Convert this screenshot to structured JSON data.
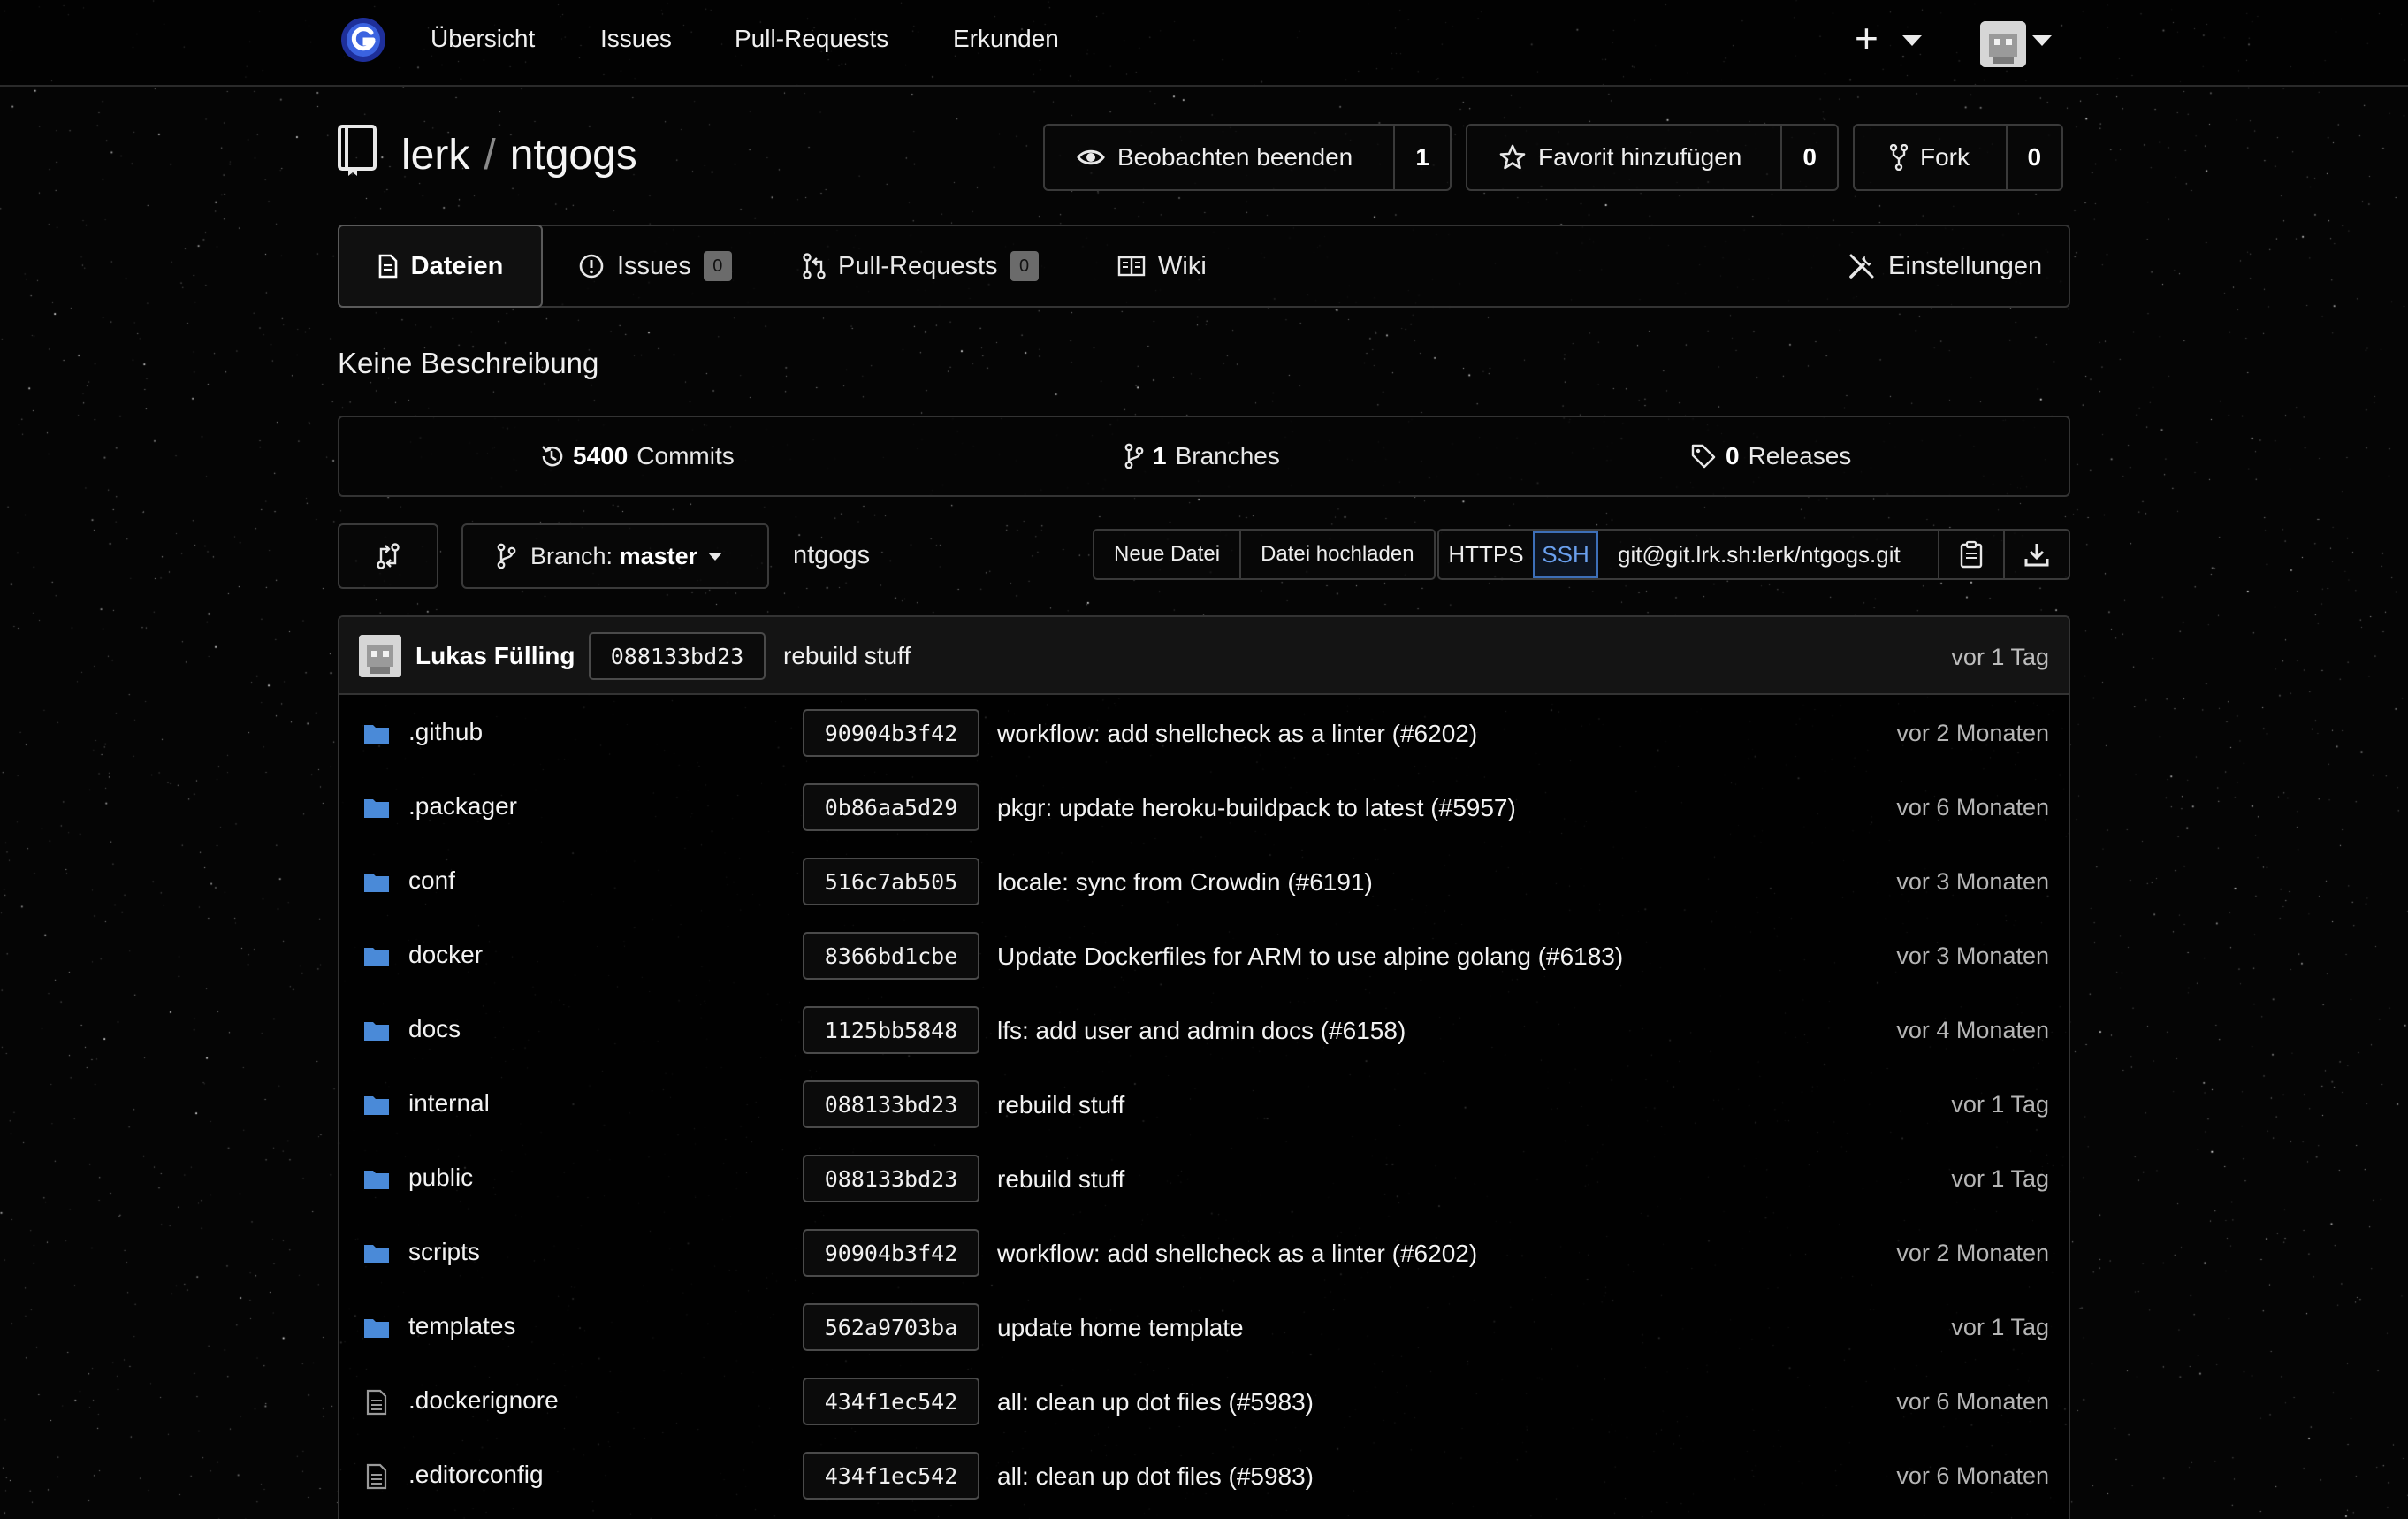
{
  "nav": {
    "links": [
      "Übersicht",
      "Issues",
      "Pull-Requests",
      "Erkunden"
    ]
  },
  "repo": {
    "owner": "lerk",
    "separator": "/",
    "name": "ntgogs",
    "watch": {
      "label": "Beobachten beenden",
      "count": "1"
    },
    "star": {
      "label": "Favorit hinzufügen",
      "count": "0"
    },
    "fork": {
      "label": "Fork",
      "count": "0"
    }
  },
  "tabs": {
    "files": "Dateien",
    "issues": "Issues",
    "issues_count": "0",
    "pulls": "Pull-Requests",
    "pulls_count": "0",
    "wiki": "Wiki",
    "settings": "Einstellungen"
  },
  "description": "Keine Beschreibung",
  "stats": {
    "commits_num": "5400",
    "commits_label": "Commits",
    "branches_num": "1",
    "branches_label": "Branches",
    "releases_num": "0",
    "releases_label": "Releases"
  },
  "toolbar": {
    "branch_prefix": "Branch:",
    "branch_name": "master",
    "path": "ntgogs",
    "new_file": "Neue Datei",
    "upload_file": "Datei hochladen",
    "https": "HTTPS",
    "ssh": "SSH",
    "clone_url": "git@git.lrk.sh:lerk/ntgogs.git"
  },
  "latest_commit": {
    "author": "Lukas Fülling",
    "sha": "088133bd23",
    "message": "rebuild stuff",
    "age": "vor 1 Tag"
  },
  "files": [
    {
      "type": "folder",
      "name": ".github",
      "sha": "90904b3f42",
      "message": "workflow: add shellcheck as a linter (#6202)",
      "age": "vor 2 Monaten"
    },
    {
      "type": "folder",
      "name": ".packager",
      "sha": "0b86aa5d29",
      "message": "pkgr: update heroku-buildpack to latest (#5957)",
      "age": "vor 6 Monaten"
    },
    {
      "type": "folder",
      "name": "conf",
      "sha": "516c7ab505",
      "message": "locale: sync from Crowdin (#6191)",
      "age": "vor 3 Monaten"
    },
    {
      "type": "folder",
      "name": "docker",
      "sha": "8366bd1cbe",
      "message": "Update Dockerfiles for ARM to use alpine golang (#6183)",
      "age": "vor 3 Monaten"
    },
    {
      "type": "folder",
      "name": "docs",
      "sha": "1125bb5848",
      "message": "lfs: add user and admin docs (#6158)",
      "age": "vor 4 Monaten"
    },
    {
      "type": "folder",
      "name": "internal",
      "sha": "088133bd23",
      "message": "rebuild stuff",
      "age": "vor 1 Tag"
    },
    {
      "type": "folder",
      "name": "public",
      "sha": "088133bd23",
      "message": "rebuild stuff",
      "age": "vor 1 Tag"
    },
    {
      "type": "folder",
      "name": "scripts",
      "sha": "90904b3f42",
      "message": "workflow: add shellcheck as a linter (#6202)",
      "age": "vor 2 Monaten"
    },
    {
      "type": "folder",
      "name": "templates",
      "sha": "562a9703ba",
      "message": "update home template",
      "age": "vor 1 Tag"
    },
    {
      "type": "file",
      "name": ".dockerignore",
      "sha": "434f1ec542",
      "message": "all: clean up dot files (#5983)",
      "age": "vor 6 Monaten"
    },
    {
      "type": "file",
      "name": ".editorconfig",
      "sha": "434f1ec542",
      "message": "all: clean up dot files (#5983)",
      "age": "vor 6 Monaten"
    }
  ],
  "colors": {
    "background": "#050505",
    "folder": "#4a8ad8",
    "ssh_active": "#3d6fb8",
    "logo": "#3b63e0"
  },
  "icons": {
    "logo": "app-logo-icon",
    "folder": "folder-icon",
    "file": "file-icon"
  }
}
